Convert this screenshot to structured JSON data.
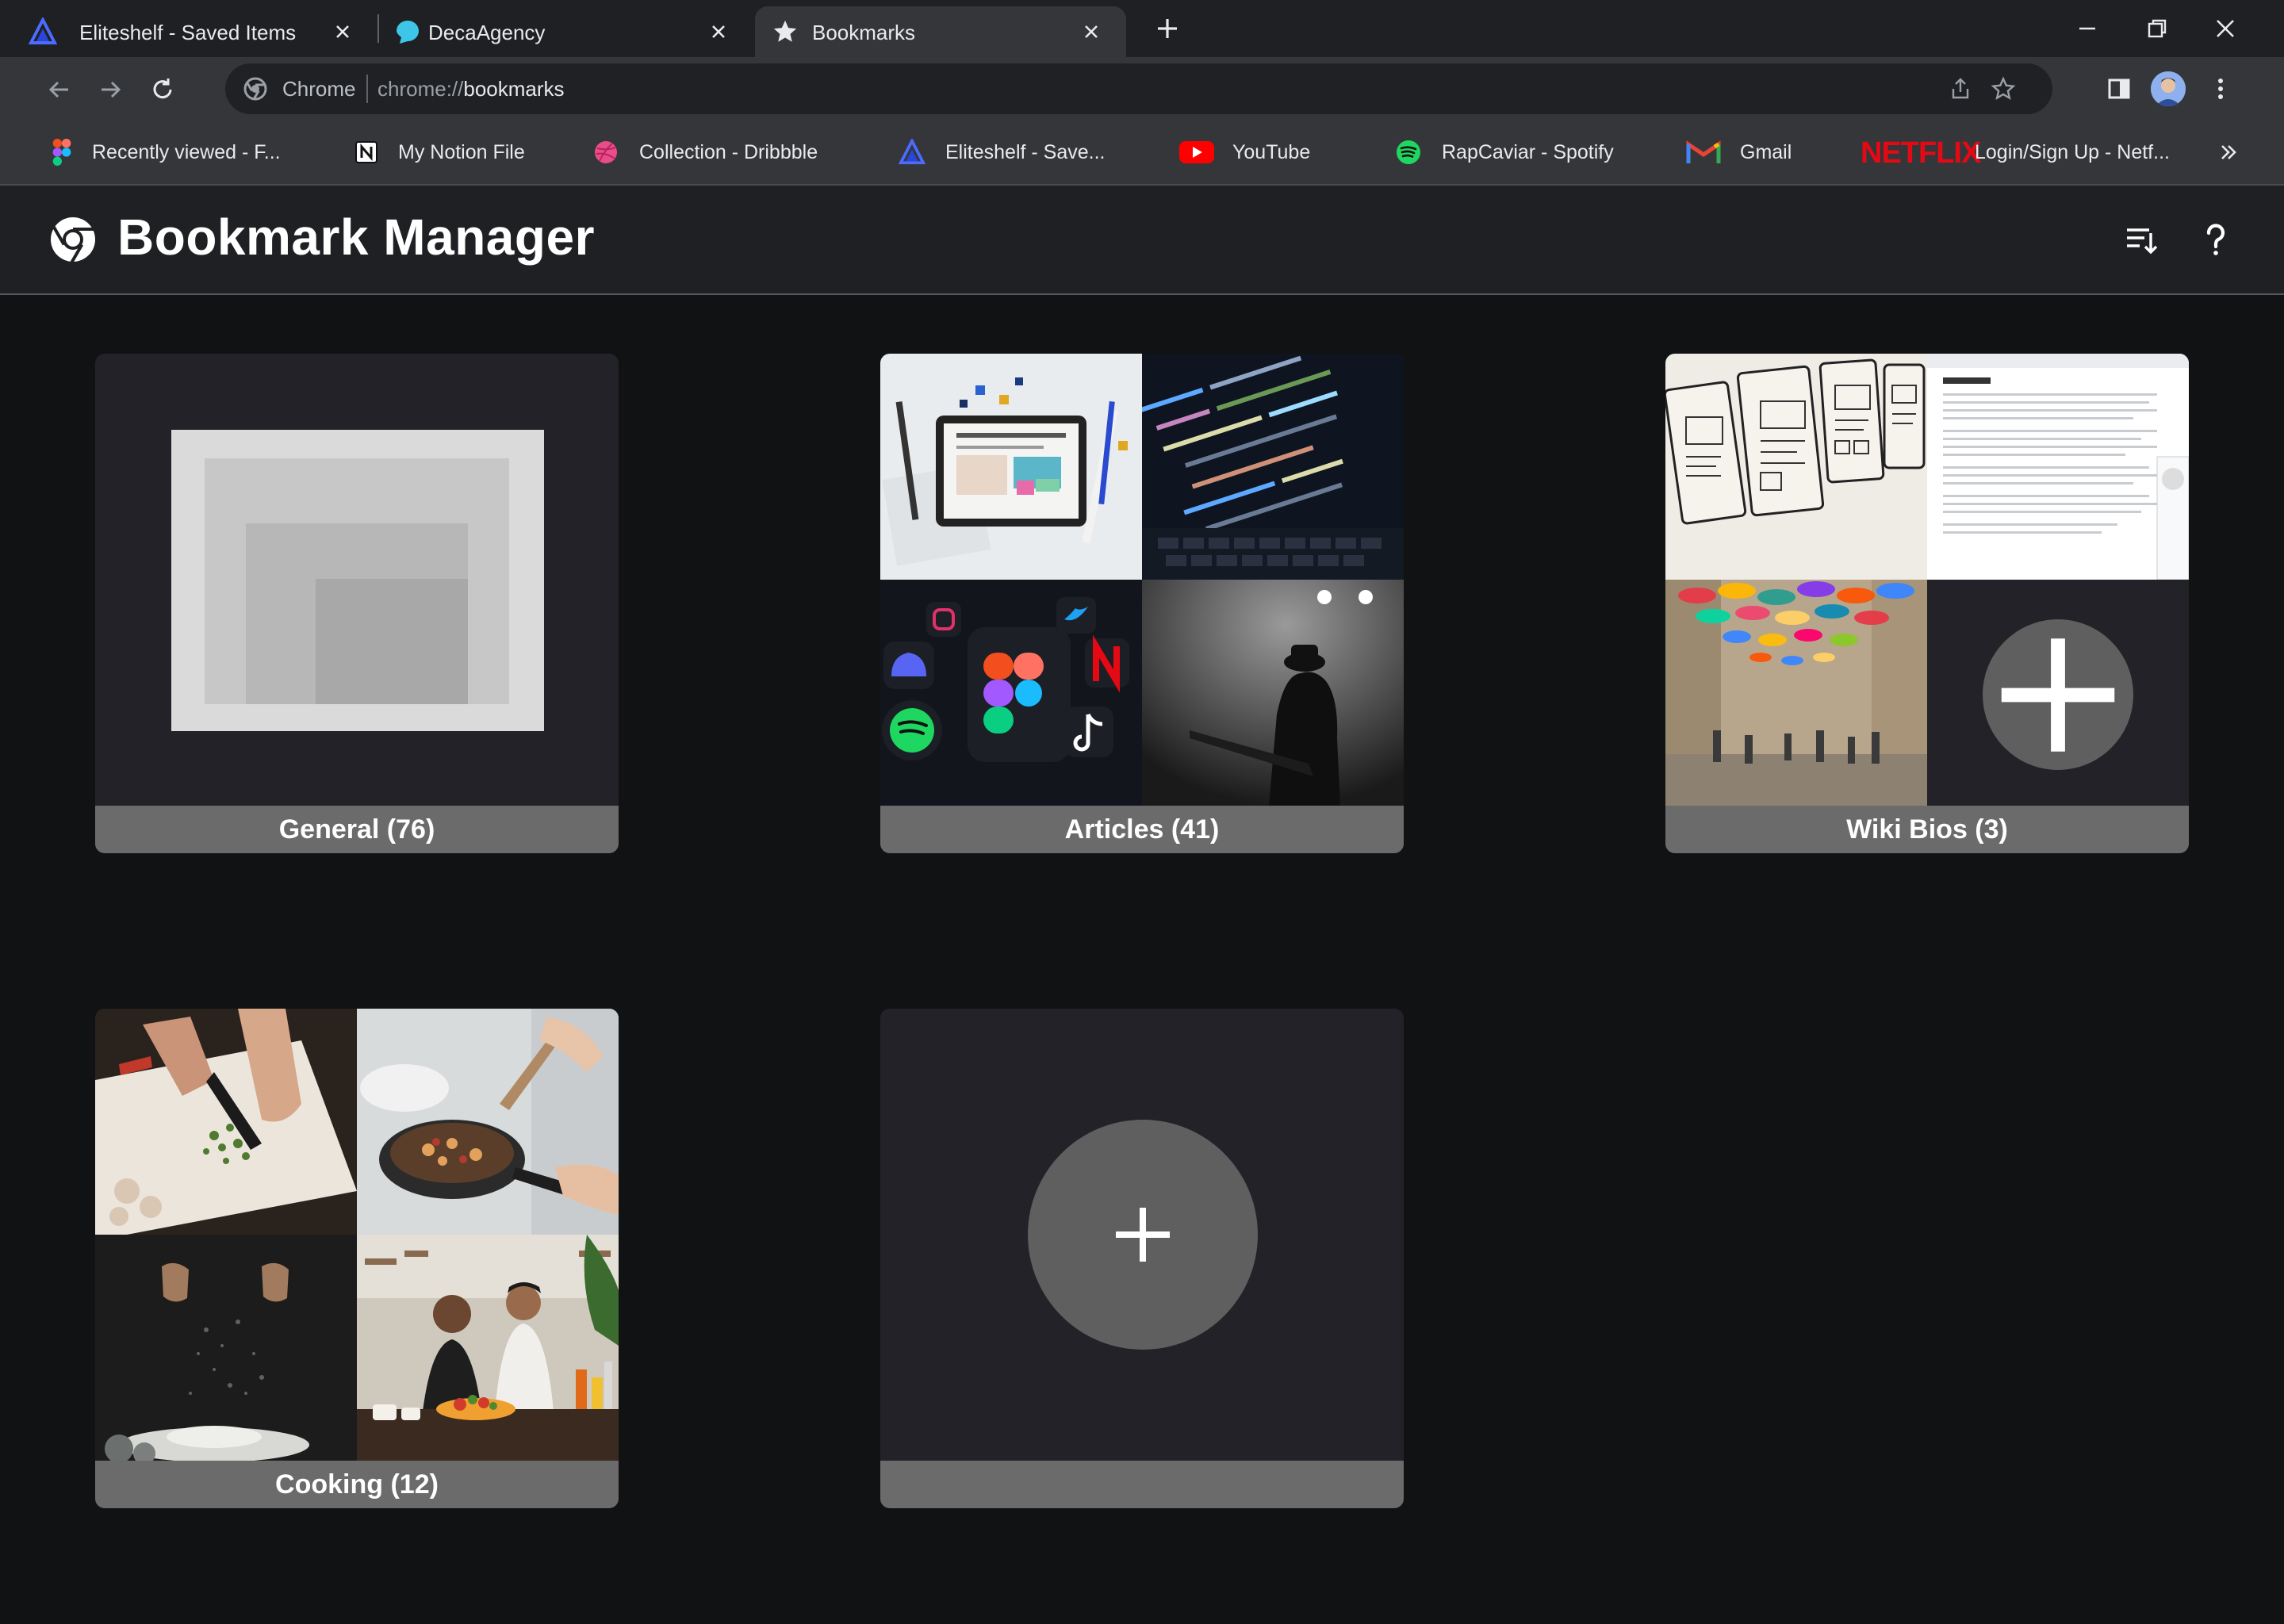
{
  "browser": {
    "tabs": [
      {
        "title": "Eliteshelf - Saved Items",
        "favicon": "eliteshelf-icon"
      },
      {
        "title": "DecaAgency",
        "favicon": "decaagency-icon"
      },
      {
        "title": "Bookmarks",
        "favicon": "star-icon",
        "active": true
      }
    ],
    "address_bar": {
      "scheme_label": "Chrome",
      "url_prefix": "chrome://",
      "url_path": "bookmarks"
    },
    "bookmarks_bar": [
      {
        "label": "Recently viewed - F...",
        "favicon": "figma-icon"
      },
      {
        "label": "My Notion File",
        "favicon": "notion-icon"
      },
      {
        "label": "Collection - Dribbble",
        "favicon": "dribbble-icon"
      },
      {
        "label": "Eliteshelf - Save...",
        "favicon": "eliteshelf-icon"
      },
      {
        "label": "YouTube",
        "favicon": "youtube-icon"
      },
      {
        "label": "RapCaviar - Spotify",
        "favicon": "spotify-icon"
      },
      {
        "label": "Gmail",
        "favicon": "gmail-icon"
      },
      {
        "label": "Login/Sign Up - Netf...",
        "favicon": "netflix-logo",
        "logo_text": "NETFLIX"
      }
    ]
  },
  "page": {
    "title": "Bookmark Manager",
    "folders": [
      {
        "label": "General (76)",
        "thumbnail": "placeholder"
      },
      {
        "label": "Articles (41)",
        "thumbnail": "mosaic"
      },
      {
        "label": "Wiki Bios (3)",
        "thumbnail": "mosaic-with-add"
      },
      {
        "label": "Cooking (12)",
        "thumbnail": "mosaic"
      },
      {
        "label": "",
        "thumbnail": "add-folder"
      }
    ]
  },
  "colors": {
    "page_bg": "#111214",
    "tabstrip_bg": "#1f2023",
    "toolbar_bg": "#35363a",
    "card_bg": "#222228",
    "card_footer": "#6b6b6b",
    "add_circle": "#5f5f5f"
  }
}
